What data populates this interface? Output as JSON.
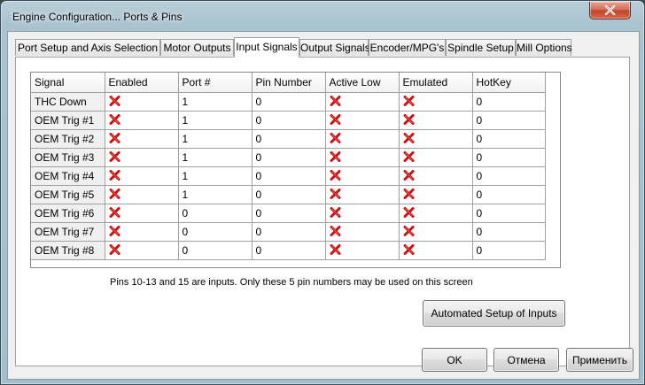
{
  "window": {
    "title": "Engine Configuration... Ports & Pins"
  },
  "tabs": [
    {
      "label": "Port Setup and Axis Selection",
      "active": false
    },
    {
      "label": "Motor Outputs",
      "active": false
    },
    {
      "label": "Input Signals",
      "active": true
    },
    {
      "label": "Output Signals",
      "active": false
    },
    {
      "label": "Encoder/MPG's",
      "active": false
    },
    {
      "label": "Spindle Setup",
      "active": false
    },
    {
      "label": "Mill Options",
      "active": false
    }
  ],
  "grid": {
    "columns": [
      "Signal",
      "Enabled",
      "Port #",
      "Pin Number",
      "Active Low",
      "Emulated",
      "HotKey"
    ],
    "rows": [
      {
        "signal": "THC Down",
        "enabled": "x-icon",
        "port": "1",
        "pin": "0",
        "active_low": "x-icon",
        "emulated": "x-icon",
        "hotkey": "0"
      },
      {
        "signal": "OEM Trig #1",
        "enabled": "x-icon",
        "port": "1",
        "pin": "0",
        "active_low": "x-icon",
        "emulated": "x-icon",
        "hotkey": "0"
      },
      {
        "signal": "OEM Trig #2",
        "enabled": "x-icon",
        "port": "1",
        "pin": "0",
        "active_low": "x-icon",
        "emulated": "x-icon",
        "hotkey": "0"
      },
      {
        "signal": "OEM Trig #3",
        "enabled": "x-icon",
        "port": "1",
        "pin": "0",
        "active_low": "x-icon",
        "emulated": "x-icon",
        "hotkey": "0"
      },
      {
        "signal": "OEM Trig #4",
        "enabled": "x-icon",
        "port": "1",
        "pin": "0",
        "active_low": "x-icon",
        "emulated": "x-icon",
        "hotkey": "0"
      },
      {
        "signal": "OEM Trig #5",
        "enabled": "x-icon",
        "port": "1",
        "pin": "0",
        "active_low": "x-icon",
        "emulated": "x-icon",
        "hotkey": "0"
      },
      {
        "signal": "OEM Trig #6",
        "enabled": "x-icon",
        "port": "0",
        "pin": "0",
        "active_low": "x-icon",
        "emulated": "x-icon",
        "hotkey": "0"
      },
      {
        "signal": "OEM Trig #7",
        "enabled": "x-icon",
        "port": "0",
        "pin": "0",
        "active_low": "x-icon",
        "emulated": "x-icon",
        "hotkey": "0"
      },
      {
        "signal": "OEM Trig #8",
        "enabled": "x-icon",
        "port": "0",
        "pin": "0",
        "active_low": "x-icon",
        "emulated": "x-icon",
        "hotkey": "0"
      }
    ]
  },
  "info_text": "Pins 10-13 and 15 are inputs. Only these 5 pin numbers may be used on this screen",
  "buttons": {
    "auto_setup": "Automated Setup of Inputs",
    "ok": "OK",
    "cancel": "Отмена",
    "apply": "Применить"
  },
  "colors": {
    "x_mark": "#d01010",
    "title_bar": "#b9cfd9",
    "close_button": "#c0452c"
  }
}
